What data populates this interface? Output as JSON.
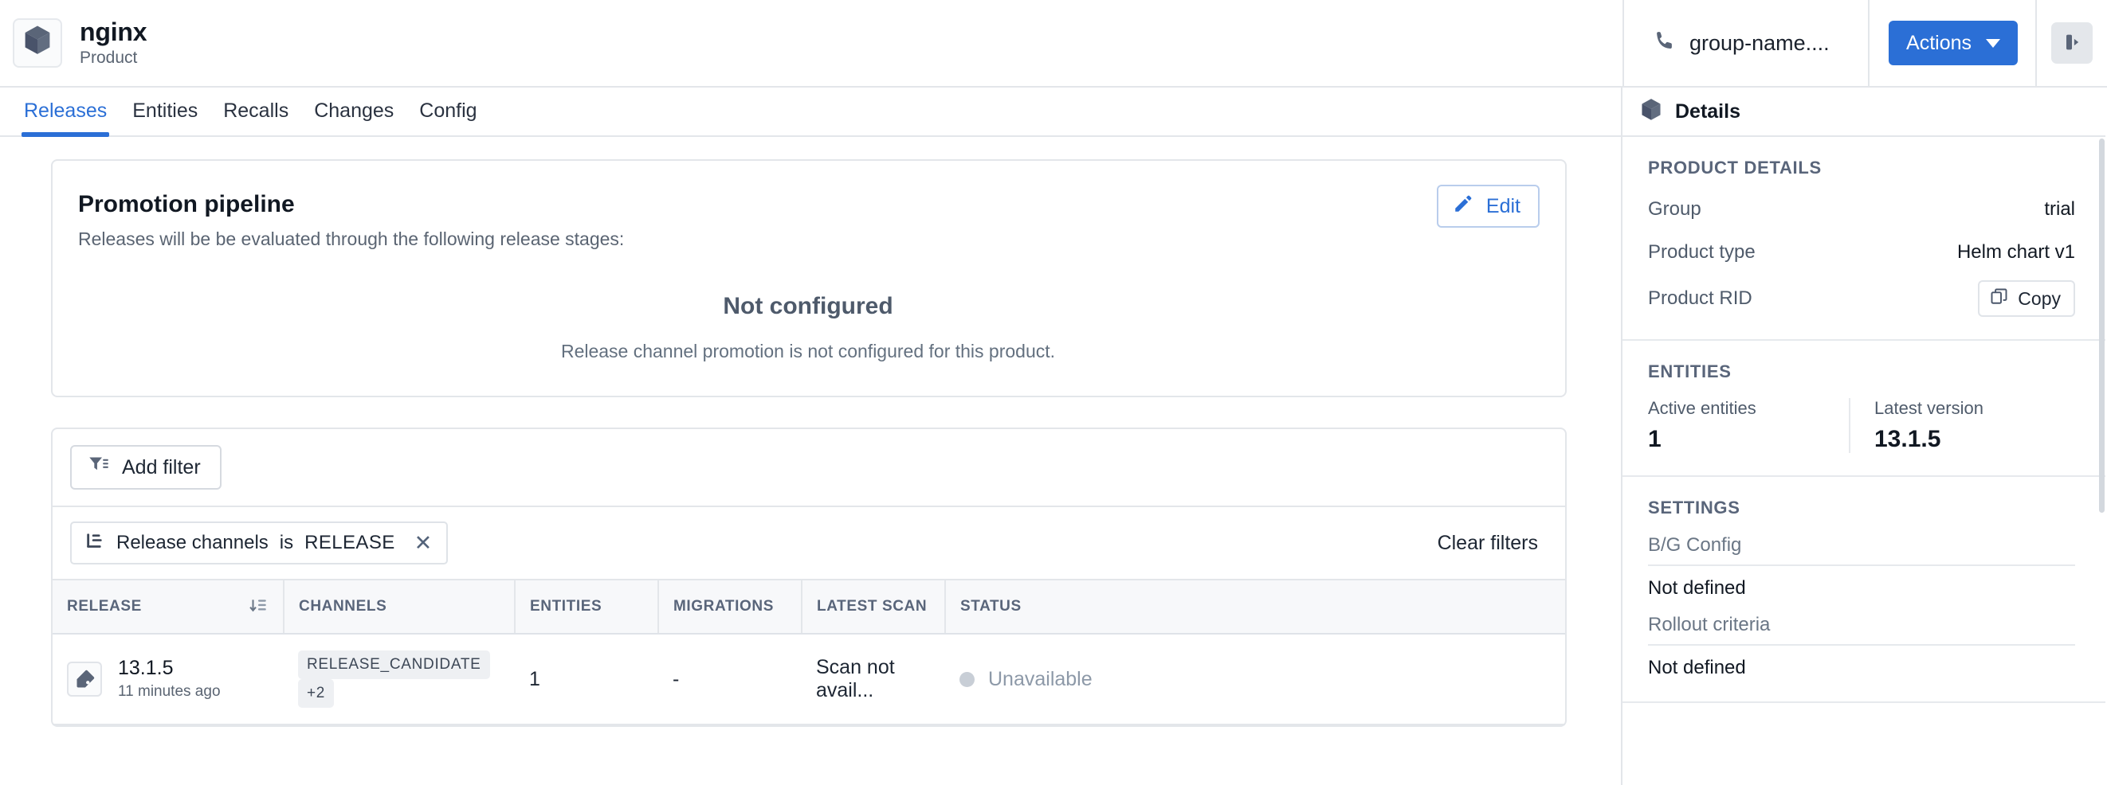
{
  "header": {
    "logo_icon": "cube-icon",
    "title": "nginx",
    "subtitle": "Product",
    "group_icon": "phone-icon",
    "group_name": "group-name....",
    "actions_label": "Actions",
    "collapse_icon": "panel-collapse-icon"
  },
  "tabs": [
    {
      "label": "Releases",
      "active": true
    },
    {
      "label": "Entities",
      "active": false
    },
    {
      "label": "Recalls",
      "active": false
    },
    {
      "label": "Changes",
      "active": false
    },
    {
      "label": "Config",
      "active": false
    }
  ],
  "pipeline": {
    "title": "Promotion pipeline",
    "subtitle": "Releases will be be evaluated through the following release stages:",
    "edit_label": "Edit",
    "edit_icon": "pencil-icon",
    "empty_title": "Not configured",
    "empty_subtitle": "Release channel promotion is not configured for this product."
  },
  "filters": {
    "add_filter_label": "Add filter",
    "add_filter_icon": "filter-icon",
    "clear_filters_label": "Clear filters",
    "chip": {
      "icon": "branch-icon",
      "label": "Release channels",
      "operator": "is",
      "value": "RELEASE",
      "remove_icon": "close-icon"
    }
  },
  "table": {
    "columns": [
      {
        "key": "release",
        "label": "RELEASE",
        "sortable": true,
        "sort_icon": "sort-desc-icon"
      },
      {
        "key": "channels",
        "label": "CHANNELS",
        "sortable": false
      },
      {
        "key": "entities",
        "label": "ENTITIES",
        "sortable": false
      },
      {
        "key": "migrations",
        "label": "MIGRATIONS",
        "sortable": false
      },
      {
        "key": "latest_scan",
        "label": "LATEST SCAN",
        "sortable": false
      },
      {
        "key": "status",
        "label": "STATUS",
        "sortable": false
      }
    ],
    "rows": [
      {
        "icon": "tag-icon",
        "version": "13.1.5",
        "ago": "11 minutes ago",
        "channels": [
          "RELEASE_CANDIDATE",
          "+2"
        ],
        "entities": "1",
        "migrations": "-",
        "latest_scan": "Scan not avail...",
        "status": "Unavailable",
        "status_color": "#c8ced6"
      }
    ]
  },
  "details": {
    "header_icon": "cube-icon",
    "header_title": "Details",
    "product_details": {
      "section_title": "PRODUCT DETAILS",
      "group_label": "Group",
      "group_value": "trial",
      "product_type_label": "Product type",
      "product_type_value": "Helm chart v1",
      "product_rid_label": "Product RID",
      "copy_label": "Copy",
      "copy_icon": "copy-icon"
    },
    "entities": {
      "section_title": "ENTITIES",
      "active_label": "Active entities",
      "active_value": "1",
      "latest_label": "Latest version",
      "latest_value": "13.1.5"
    },
    "settings": {
      "section_title": "SETTINGS",
      "bg_config_label": "B/G Config",
      "bg_config_value": "Not defined",
      "rollout_label": "Rollout criteria",
      "rollout_value": "Not defined"
    }
  },
  "colors": {
    "accent": "#2b6fd6",
    "border": "#e3e6ea",
    "muted_text": "#5a6472",
    "status_unavailable": "#c8ced6"
  }
}
